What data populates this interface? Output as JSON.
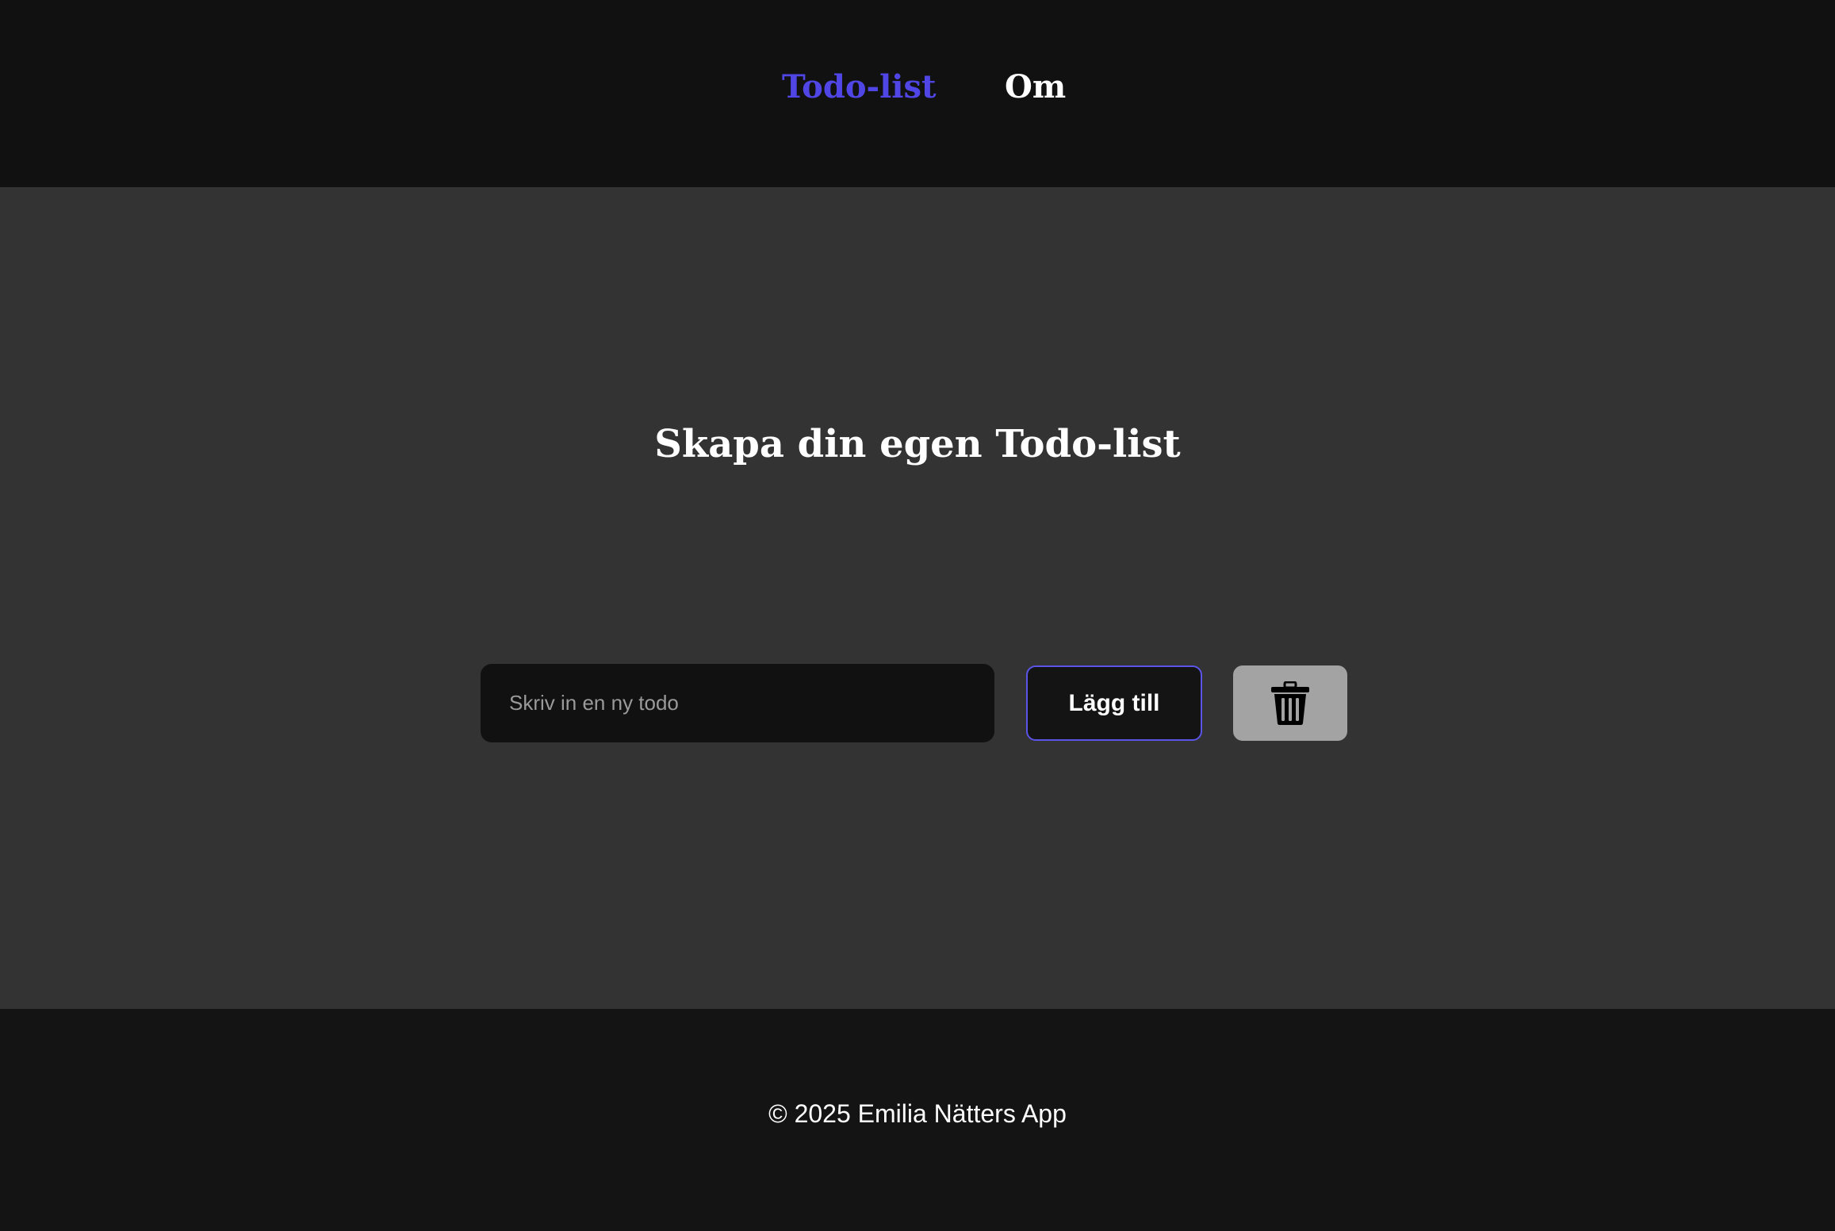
{
  "nav": {
    "items": [
      {
        "label": "Todo-list",
        "active": true
      },
      {
        "label": "Om",
        "active": false
      }
    ]
  },
  "main": {
    "title": "Skapa din egen Todo-list",
    "todo_input": {
      "value": "",
      "placeholder": "Skriv in en ny todo"
    },
    "add_button_label": "Lägg till",
    "delete_button_icon": "trash-icon"
  },
  "footer": {
    "text": "© 2025 Emilia Nätters App"
  },
  "colors": {
    "nav_background": "#111111",
    "main_background": "#333333",
    "footer_background": "#141414",
    "accent": "#4f46e5",
    "input_background": "#111111",
    "delete_button_background": "#a3a3a3",
    "text": "#ffffff",
    "placeholder": "#9a9a9a"
  }
}
